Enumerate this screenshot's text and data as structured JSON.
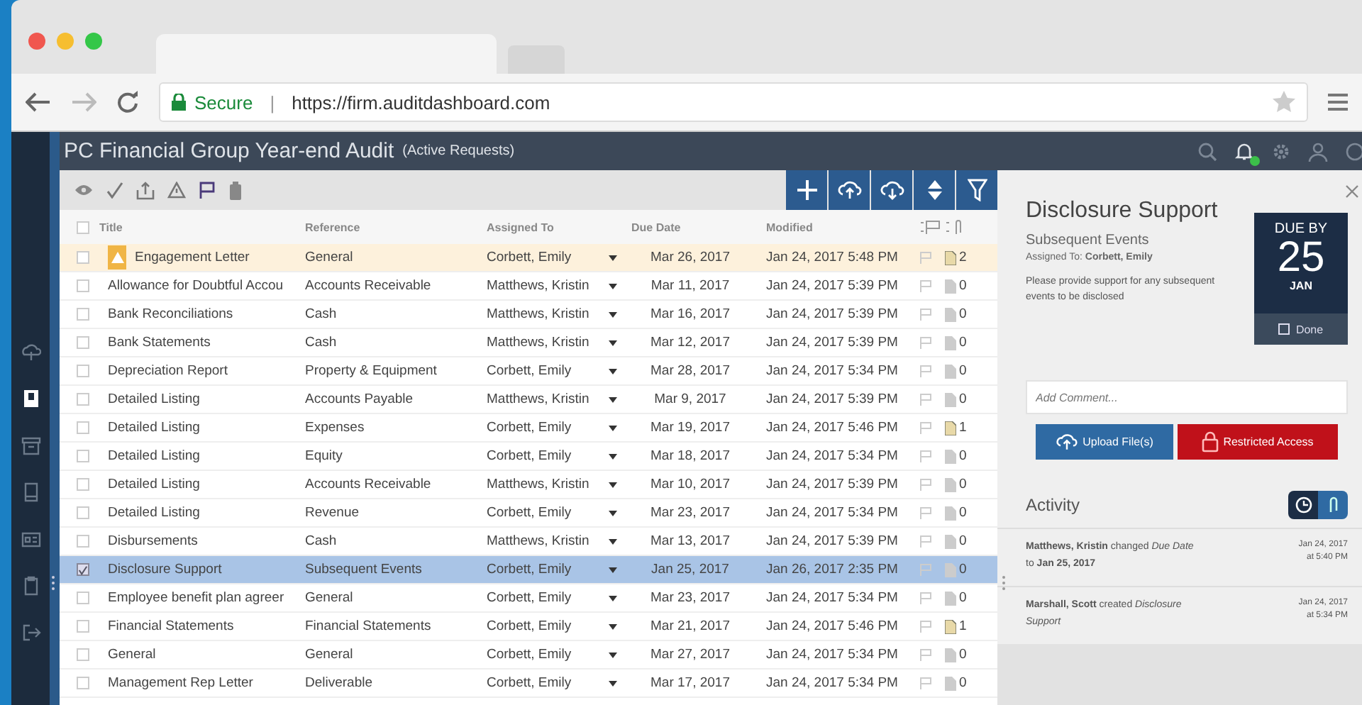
{
  "browser": {
    "secure_label": "Secure",
    "separator": "|",
    "url": "https://firm.auditdashboard.com"
  },
  "header": {
    "title": "PC Financial Group Year-end Audit",
    "subtitle": "(Active Requests)",
    "notification_dot": true
  },
  "sidebar": {
    "items": [
      {
        "selected": false
      },
      {
        "selected": true
      },
      {
        "selected": false
      },
      {
        "selected": false
      },
      {
        "selected": false
      },
      {
        "selected": false
      },
      {
        "selected": false
      }
    ]
  },
  "table": {
    "columns": [
      "Title",
      "Reference",
      "Assigned To",
      "Due Date",
      "Modified"
    ],
    "select_all": false,
    "rows": [
      {
        "title": "Engagement Letter",
        "reference": "General",
        "assigned": "Corbett, Emily",
        "due": "Mar 26, 2017",
        "modified": "Jan 24, 2017 5:48 PM",
        "files": "2",
        "has_files": true,
        "warning": true,
        "selected": false,
        "checked": false
      },
      {
        "title": "Allowance for Doubtful Accou",
        "reference": "Accounts Receivable",
        "assigned": "Matthews, Kristin",
        "due": "Mar 11, 2017",
        "modified": "Jan 24, 2017 5:39 PM",
        "files": "0",
        "has_files": false,
        "warning": false,
        "selected": false,
        "checked": false
      },
      {
        "title": "Bank Reconciliations",
        "reference": "Cash",
        "assigned": "Matthews, Kristin",
        "due": "Mar 16, 2017",
        "modified": "Jan 24, 2017 5:39 PM",
        "files": "0",
        "has_files": false,
        "warning": false,
        "selected": false,
        "checked": false
      },
      {
        "title": "Bank Statements",
        "reference": "Cash",
        "assigned": "Matthews, Kristin",
        "due": "Mar 12, 2017",
        "modified": "Jan 24, 2017 5:39 PM",
        "files": "0",
        "has_files": false,
        "warning": false,
        "selected": false,
        "checked": false
      },
      {
        "title": "Depreciation Report",
        "reference": "Property & Equipment",
        "assigned": "Corbett, Emily",
        "due": "Mar 28, 2017",
        "modified": "Jan 24, 2017 5:34 PM",
        "files": "0",
        "has_files": false,
        "warning": false,
        "selected": false,
        "checked": false
      },
      {
        "title": "Detailed Listing",
        "reference": "Accounts Payable",
        "assigned": "Matthews, Kristin",
        "due": "Mar 9, 2017",
        "modified": "Jan 24, 2017 5:39 PM",
        "files": "0",
        "has_files": false,
        "warning": false,
        "selected": false,
        "checked": false
      },
      {
        "title": "Detailed Listing",
        "reference": "Expenses",
        "assigned": "Corbett, Emily",
        "due": "Mar 19, 2017",
        "modified": "Jan 24, 2017 5:46 PM",
        "files": "1",
        "has_files": true,
        "warning": false,
        "selected": false,
        "checked": false
      },
      {
        "title": "Detailed Listing",
        "reference": "Equity",
        "assigned": "Corbett, Emily",
        "due": "Mar 18, 2017",
        "modified": "Jan 24, 2017 5:34 PM",
        "files": "0",
        "has_files": false,
        "warning": false,
        "selected": false,
        "checked": false
      },
      {
        "title": "Detailed Listing",
        "reference": "Accounts Receivable",
        "assigned": "Matthews, Kristin",
        "due": "Mar 10, 2017",
        "modified": "Jan 24, 2017 5:39 PM",
        "files": "0",
        "has_files": false,
        "warning": false,
        "selected": false,
        "checked": false
      },
      {
        "title": "Detailed Listing",
        "reference": "Revenue",
        "assigned": "Corbett, Emily",
        "due": "Mar 23, 2017",
        "modified": "Jan 24, 2017 5:34 PM",
        "files": "0",
        "has_files": false,
        "warning": false,
        "selected": false,
        "checked": false
      },
      {
        "title": "Disbursements",
        "reference": "Cash",
        "assigned": "Matthews, Kristin",
        "due": "Mar 13, 2017",
        "modified": "Jan 24, 2017 5:39 PM",
        "files": "0",
        "has_files": false,
        "warning": false,
        "selected": false,
        "checked": false
      },
      {
        "title": "Disclosure Support",
        "reference": "Subsequent Events",
        "assigned": "Corbett, Emily",
        "due": "Jan 25, 2017",
        "modified": "Jan 26, 2017 2:35 PM",
        "files": "0",
        "has_files": false,
        "warning": false,
        "selected": true,
        "checked": true
      },
      {
        "title": "Employee benefit plan agreer",
        "reference": "General",
        "assigned": "Corbett, Emily",
        "due": "Mar 23, 2017",
        "modified": "Jan 24, 2017 5:34 PM",
        "files": "0",
        "has_files": false,
        "warning": false,
        "selected": false,
        "checked": false
      },
      {
        "title": "Financial Statements",
        "reference": "Financial Statements",
        "assigned": "Corbett, Emily",
        "due": "Mar 21, 2017",
        "modified": "Jan 24, 2017 5:46 PM",
        "files": "1",
        "has_files": true,
        "warning": false,
        "selected": false,
        "checked": false
      },
      {
        "title": "General",
        "reference": "General",
        "assigned": "Corbett, Emily",
        "due": "Mar 27, 2017",
        "modified": "Jan 24, 2017 5:34 PM",
        "files": "0",
        "has_files": false,
        "warning": false,
        "selected": false,
        "checked": false
      },
      {
        "title": "Management Rep Letter",
        "reference": "Deliverable",
        "assigned": "Corbett, Emily",
        "due": "Mar 17, 2017",
        "modified": "Jan 24, 2017 5:34 PM",
        "files": "0",
        "has_files": false,
        "warning": false,
        "selected": false,
        "checked": false
      }
    ]
  },
  "detail": {
    "title": "Disclosure Support",
    "reference": "Subsequent Events",
    "assigned": "Assigned To: **Corbett, Emily**",
    "description": "Please provide support for any subsequent events to be disclosed",
    "due_label": "DUE BY",
    "due_day": "25",
    "due_month": "JAN",
    "done_label": "Done",
    "done": false,
    "comment": {
      "placeholder": "Add Comment..."
    },
    "upload_button": "Upload File(s)",
    "restricted_button": "Restricted Access",
    "activity_title": "Activity",
    "activity_tabs": [
      {
        "selected": true
      },
      {
        "selected": false
      }
    ],
    "activity": [
      {
        "text": "**Matthews, Kristin** changed *Due Date* to **Jan 25, 2017**",
        "date": "Jan 24, 2017",
        "time": "at 5:40 PM"
      },
      {
        "text": "**Marshall, Scott** created *Disclosure Support*",
        "date": "Jan 24, 2017",
        "time": "at 5:34 PM"
      }
    ]
  }
}
